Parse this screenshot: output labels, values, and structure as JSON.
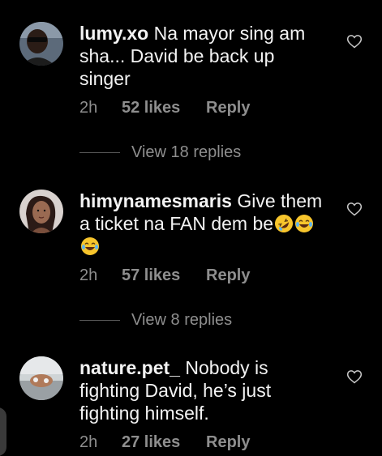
{
  "comments": [
    {
      "username": "lumy.xo",
      "text_lines": [
        "Na mayor sing am",
        "sha... David be back up",
        "singer"
      ],
      "time": "2h",
      "likes": "52 likes",
      "reply": "Reply",
      "view_replies": "View 18 replies"
    },
    {
      "username": "himynamesmaris",
      "text_lines": [
        "Give them",
        "a ticket na FAN dem be"
      ],
      "emojis": [
        "rolling-on-floor-laughing-emoji",
        "face-with-tears-of-joy-emoji",
        "face-with-tears-of-joy-emoji"
      ],
      "time": "2h",
      "likes": "57 likes",
      "reply": "Reply",
      "view_replies": "View 8 replies"
    },
    {
      "username": "nature.pet_",
      "text_lines": [
        "Nobody is",
        "fighting David, he’s  just",
        "fighting himself."
      ],
      "time": "2h",
      "likes": "27 likes",
      "reply": "Reply"
    }
  ],
  "colors": {
    "background": "#000000",
    "text": "#f3f3f3",
    "muted": "#8e8e8e"
  }
}
